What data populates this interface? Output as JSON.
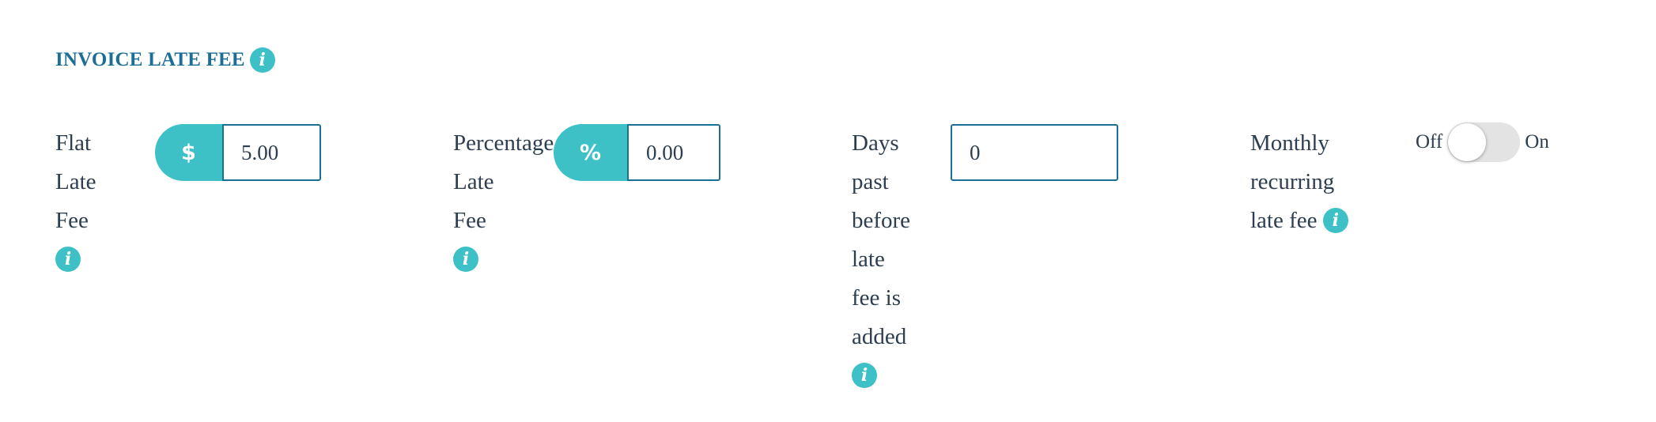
{
  "section": {
    "title": "INVOICE LATE FEE"
  },
  "flat_fee": {
    "label_lines": [
      "Flat",
      "Late",
      "Fee"
    ],
    "addon": "$",
    "value": "5.00"
  },
  "percentage_fee": {
    "label_lines": [
      "Percentage",
      "Late",
      "Fee"
    ],
    "addon": "%",
    "value": "0.00"
  },
  "days_past": {
    "label_lines": [
      "Days",
      "past",
      "before",
      "late",
      "fee is",
      "added"
    ],
    "value": "0"
  },
  "monthly_recurring": {
    "label_lines": [
      "Monthly",
      "recurring",
      "late fee"
    ],
    "off_label": "Off",
    "on_label": "On",
    "state": "Off"
  },
  "info_glyph": "i",
  "colors": {
    "accent": "#3ec1c6",
    "title": "#1b6e95",
    "text": "#2c3e50",
    "toggle_track": "#e3e3e3"
  }
}
